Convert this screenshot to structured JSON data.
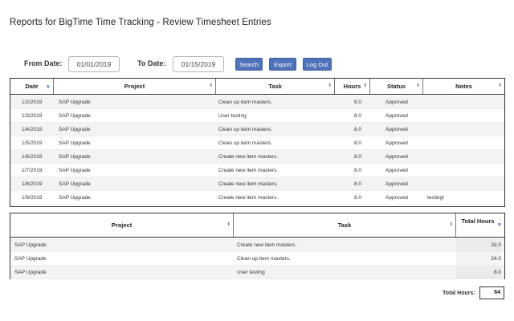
{
  "page": {
    "title": "Reports for BigTime Time Tracking - Review Timesheet Entries"
  },
  "filters": {
    "from_label": "From Date:",
    "from_value": "01/01/2019",
    "to_label": "To Date:",
    "to_value": "01/15/2019",
    "search_label": "Search",
    "export_label": "Export",
    "logout_label": "Log Out"
  },
  "entries": {
    "headers": [
      "Date",
      "Project",
      "Task",
      "Hours",
      "Status",
      "Notes"
    ],
    "sorted_column": "Date",
    "rows": [
      {
        "date": "1/2/2019",
        "project": "SAP Upgrade",
        "task": "Clean up item masters.",
        "hours": "8.0",
        "status": "Approved",
        "notes": ""
      },
      {
        "date": "1/3/2019",
        "project": "SAP Upgrade",
        "task": "User testing",
        "hours": "8.0",
        "status": "Approved",
        "notes": ""
      },
      {
        "date": "1/4/2019",
        "project": "SAP Upgrade",
        "task": "Clean up item masters.",
        "hours": "8.0",
        "status": "Approved",
        "notes": ""
      },
      {
        "date": "1/5/2019",
        "project": "SAP Upgrade",
        "task": "Clean up item masters.",
        "hours": "8.0",
        "status": "Approved",
        "notes": ""
      },
      {
        "date": "1/6/2019",
        "project": "SAP Upgrade",
        "task": "Create new item masters.",
        "hours": "8.0",
        "status": "Approved",
        "notes": ""
      },
      {
        "date": "1/7/2019",
        "project": "SAP Upgrade",
        "task": "Create new item masters.",
        "hours": "8.0",
        "status": "Approved",
        "notes": ""
      },
      {
        "date": "1/8/2019",
        "project": "SAP Upgrade",
        "task": "Create new item masters.",
        "hours": "8.0",
        "status": "Approved",
        "notes": ""
      },
      {
        "date": "1/9/2019",
        "project": "SAP Upgrade",
        "task": "Create new item masters.",
        "hours": "8.0",
        "status": "Approved",
        "notes": "testing!"
      }
    ]
  },
  "summary": {
    "headers": [
      "Project",
      "Task",
      "Total Hours"
    ],
    "rows": [
      {
        "project": "SAP Upgrade",
        "task": "Create new item masters.",
        "total": "32.0"
      },
      {
        "project": "SAP Upgrade",
        "task": "Clean up item masters.",
        "total": "24.0"
      },
      {
        "project": "SAP Upgrade",
        "task": "User testing",
        "total": "8.0"
      }
    ]
  },
  "totals": {
    "label": "Total Hours:",
    "value": "64"
  },
  "colors": {
    "button": "#4f72b8",
    "stripe": "#f3f3f3",
    "border": "#333333"
  }
}
